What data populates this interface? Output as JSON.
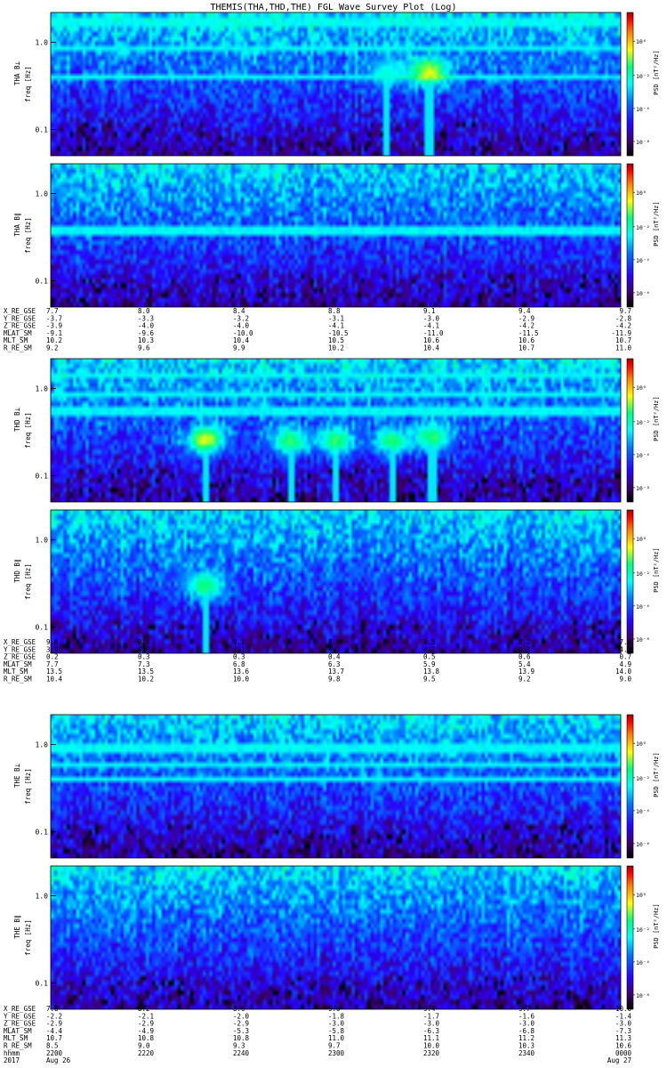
{
  "title": "THEMIS(THA,THD,THE) FGL Wave Survey Plot (Log)",
  "chart_data": {
    "type": "heatmap",
    "ytick_labels": [
      "1.0",
      "0.1"
    ],
    "ytick_values": [
      1.0,
      0.1
    ],
    "ylim": [
      0.05,
      2.2
    ],
    "yscale": "log",
    "colorbar": {
      "label": "PSD [nT²/Hz]",
      "scale": "log",
      "range": [
        1e-08,
        100
      ],
      "tick_labels": [
        "10⁰",
        "10⁻²",
        "10⁻⁴",
        "10⁻⁶"
      ],
      "tick_values": [
        1,
        0.01,
        0.0001,
        1e-06
      ],
      "colors": [
        "#000000",
        "#3c0068",
        "#2800ff",
        "#0078ff",
        "#00ffff",
        "#00ff80",
        "#ffff00",
        "#ff8000",
        "#ff0000",
        "#a00000"
      ]
    },
    "panels": [
      {
        "ylabel": "THA B⊥",
        "ylabel2": "freq [Hz]",
        "cbar_ticks": [
          "10⁰",
          "10⁻²",
          "10⁻⁴",
          "10⁻⁸"
        ],
        "bright_bands": [
          1.7,
          0.85,
          0.4
        ],
        "features": [
          {
            "t": 0.59,
            "f": 0.45,
            "level": "cyan"
          },
          {
            "t": 0.665,
            "f": 0.45,
            "level": "yellow"
          }
        ]
      },
      {
        "ylabel": "THA B∥",
        "ylabel2": "freq [Hz]",
        "cbar_ticks": [
          "10⁰",
          "10⁻²",
          "10⁻⁴",
          "10⁻⁶"
        ],
        "bright_bands": [
          0.38
        ],
        "features": []
      },
      {
        "ylabel": "THD B⊥",
        "ylabel2": "freq [Hz]",
        "cbar_ticks": [
          "10⁰",
          "10⁻²",
          "10⁻⁴",
          "10⁻⁸"
        ],
        "bright_bands": [
          1.4,
          0.85,
          0.55
        ],
        "features": [
          {
            "t": 0.27,
            "f": 0.26,
            "level": "yellow"
          },
          {
            "t": 0.42,
            "f": 0.25,
            "level": "green"
          },
          {
            "t": 0.5,
            "f": 0.25,
            "level": "green"
          },
          {
            "t": 0.6,
            "f": 0.25,
            "level": "green"
          },
          {
            "t": 0.67,
            "f": 0.28,
            "level": "green"
          }
        ]
      },
      {
        "ylabel": "THD B∥",
        "ylabel2": "freq [Hz]",
        "cbar_ticks": [
          "10⁰",
          "10⁻²",
          "10⁻⁴",
          "10⁻⁸"
        ],
        "bright_bands": [],
        "features": [
          {
            "t": 0.27,
            "f": 0.3,
            "level": "green"
          }
        ]
      },
      {
        "ylabel": "THE B⊥",
        "ylabel2": "freq [Hz]",
        "cbar_ticks": [
          "10⁰",
          "10⁻²",
          "10⁻⁴",
          "10⁻⁶"
        ],
        "bright_bands": [
          0.9,
          0.6,
          0.4
        ],
        "features": []
      },
      {
        "ylabel": "THE B∥",
        "ylabel2": "freq [Hz]",
        "cbar_ticks": [
          "10⁰",
          "10⁻²",
          "10⁻⁴",
          "10⁻⁸"
        ],
        "bright_bands": [],
        "features": []
      }
    ],
    "ephemeris_blocks": [
      {
        "rows": [
          {
            "label": "X_RE_GSE",
            "values": [
              "7.7",
              "8.0",
              "8.4",
              "8.8",
              "9.1",
              "9.4",
              "9.7"
            ]
          },
          {
            "label": "Y_RE_GSE",
            "values": [
              "-3.7",
              "-3.3",
              "-3.2",
              "-3.1",
              "-3.0",
              "-2.9",
              "-2.8"
            ]
          },
          {
            "label": "Z_RE_GSE",
            "values": [
              "-3.9",
              "-4.0",
              "-4.0",
              "-4.1",
              "-4.1",
              "-4.2",
              "-4.2"
            ]
          },
          {
            "label": "MLAT_SM",
            "values": [
              "-9.1",
              "-9.6",
              "-10.0",
              "-10.5",
              "-11.0",
              "-11.5",
              "-11.9"
            ]
          },
          {
            "label": "MLT_SM",
            "values": [
              "10.2",
              "10.3",
              "10.4",
              "10.5",
              "10.6",
              "10.6",
              "10.7"
            ]
          },
          {
            "label": "R_RE_SM",
            "values": [
              "9.2",
              "9.6",
              "9.9",
              "10.2",
              "10.4",
              "10.7",
              "11.0"
            ]
          }
        ]
      },
      {
        "rows": [
          {
            "label": "X_RE_GSE",
            "values": [
              "9.6",
              "9.4",
              "9.1",
              "8.8",
              "8.5",
              "8.2",
              "7.8"
            ]
          },
          {
            "label": "Y_RE_GSE",
            "values": [
              "3.9",
              "4.0",
              "4.1",
              "4.2",
              "4.2",
              "4.3",
              "4.3"
            ]
          },
          {
            "label": "Z_RE_GSE",
            "values": [
              "0.2",
              "0.3",
              "0.3",
              "0.4",
              "0.5",
              "0.6",
              "0.7"
            ]
          },
          {
            "label": "MLAT_SM",
            "values": [
              "7.7",
              "7.3",
              "6.8",
              "6.3",
              "5.9",
              "5.4",
              "4.9"
            ]
          },
          {
            "label": "MLT_SM",
            "values": [
              "13.5",
              "13.5",
              "13.6",
              "13.7",
              "13.8",
              "13.9",
              "14.0"
            ]
          },
          {
            "label": "R_RE_SM",
            "values": [
              "10.4",
              "10.2",
              "10.0",
              "9.8",
              "9.5",
              "9.2",
              "9.0"
            ]
          }
        ]
      },
      {
        "rows": [
          {
            "label": "X_RE_GSE",
            "values": [
              "7.8",
              "8.2",
              "8.6",
              "9.0",
              "9.4",
              "9.7",
              "10.0"
            ]
          },
          {
            "label": "Y_RE_GSE",
            "values": [
              "-2.2",
              "-2.1",
              "-2.0",
              "-1.8",
              "-1.7",
              "-1.6",
              "-1.4"
            ]
          },
          {
            "label": "Z_RE_GSE",
            "values": [
              "-2.9",
              "-2.9",
              "-2.9",
              "-3.0",
              "-3.0",
              "-3.0",
              "-3.0"
            ]
          },
          {
            "label": "MLAT_SM",
            "values": [
              "-4.4",
              "-4.9",
              "-5.3",
              "-5.8",
              "-6.3",
              "-6.8",
              "-7.3"
            ]
          },
          {
            "label": "MLT_SM",
            "values": [
              "10.7",
              "10.8",
              "10.8",
              "11.0",
              "11.1",
              "11.2",
              "11.3"
            ]
          },
          {
            "label": "R_RE_SM",
            "values": [
              "8.5",
              "9.0",
              "9.3",
              "9.7",
              "10.0",
              "10.3",
              "10.6"
            ]
          },
          {
            "label": "hhmm",
            "values": [
              "2200",
              "2220",
              "2240",
              "2300",
              "2320",
              "2340",
              "0000"
            ]
          }
        ]
      }
    ],
    "date_labels": [
      "2017",
      "Aug 26",
      "Aug 27"
    ]
  }
}
